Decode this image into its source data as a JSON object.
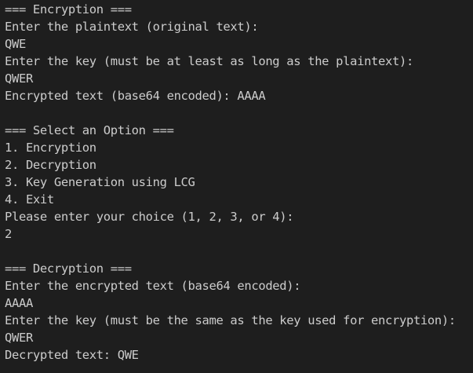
{
  "encryption": {
    "header": "=== Encryption ===",
    "plaintext_prompt": "Enter the plaintext (original text):",
    "plaintext_value": "QWE",
    "key_prompt": "Enter the key (must be at least as long as the plaintext):",
    "key_value": "QWER",
    "result": "Encrypted text (base64 encoded): AAAA"
  },
  "menu": {
    "header": "=== Select an Option ===",
    "options": [
      "1. Encryption",
      "2. Decryption",
      "3. Key Generation using LCG",
      "4. Exit"
    ],
    "choice_prompt": "Please enter your choice (1, 2, 3, or 4):",
    "choice_value": "2"
  },
  "decryption": {
    "header": "=== Decryption ===",
    "ciphertext_prompt": "Enter the encrypted text (base64 encoded):",
    "ciphertext_value": "AAAA",
    "key_prompt": "Enter the key (must be the same as the key used for encryption):",
    "key_value": "QWER",
    "result": "Decrypted text: QWE"
  },
  "colors": {
    "background": "#1e1e1e",
    "text": "#cccccc"
  }
}
